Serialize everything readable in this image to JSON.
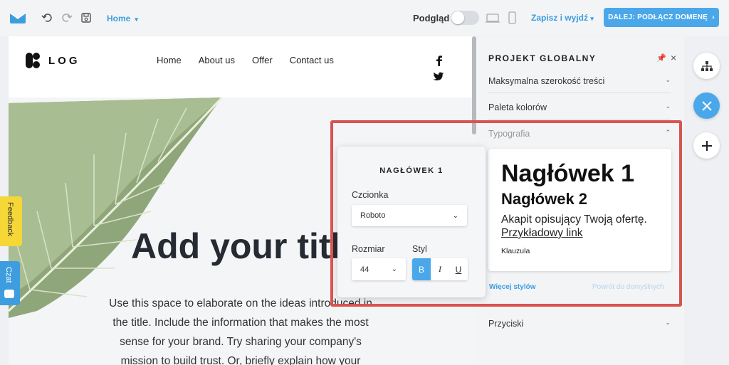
{
  "topbar": {
    "page_select": "Home",
    "preview_label": "Podgląd",
    "save_exit": "Zapisz i wyjdź",
    "next_button": "DALEJ: PODŁĄCZ DOMENĘ"
  },
  "site": {
    "brand": "LOG",
    "nav": [
      "Home",
      "About us",
      "Offer",
      "Contact us"
    ],
    "hero_title": "Add your title",
    "hero_body": "Use this space to elaborate on the ideas introduced in the title. Include the information that makes the most sense for your brand. Try sharing your company's mission to build trust. Or, briefly explain how your"
  },
  "side_tabs": {
    "feedback": "Feedback",
    "chat": "Czat"
  },
  "panel": {
    "title": "PROJEKT GLOBALNY",
    "items": {
      "max_width": "Maksymalna szerokość treści",
      "palette": "Paleta kolorów",
      "typography": "Typografia",
      "buttons": "Przyciski"
    },
    "preview": {
      "h1": "Nagłówek 1",
      "h2": "Nagłówek 2",
      "paragraph": "Akapit opisujący Twoją ofertę.",
      "link": "Przykładowy link",
      "small": "Klauzula"
    },
    "more_styles": "Więcej stylów",
    "reset_defaults": "Powrót do domyślnych"
  },
  "popover": {
    "title": "NAGŁÓWEK 1",
    "font_label": "Czcionka",
    "font_value": "Roboto",
    "size_label": "Rozmiar",
    "size_value": "44",
    "style_label": "Styl",
    "style_buttons": [
      "B",
      "I",
      "U"
    ]
  },
  "colors": {
    "accent": "#4aa8ea",
    "highlight": "#d9534f",
    "feedback": "#f5d737"
  }
}
